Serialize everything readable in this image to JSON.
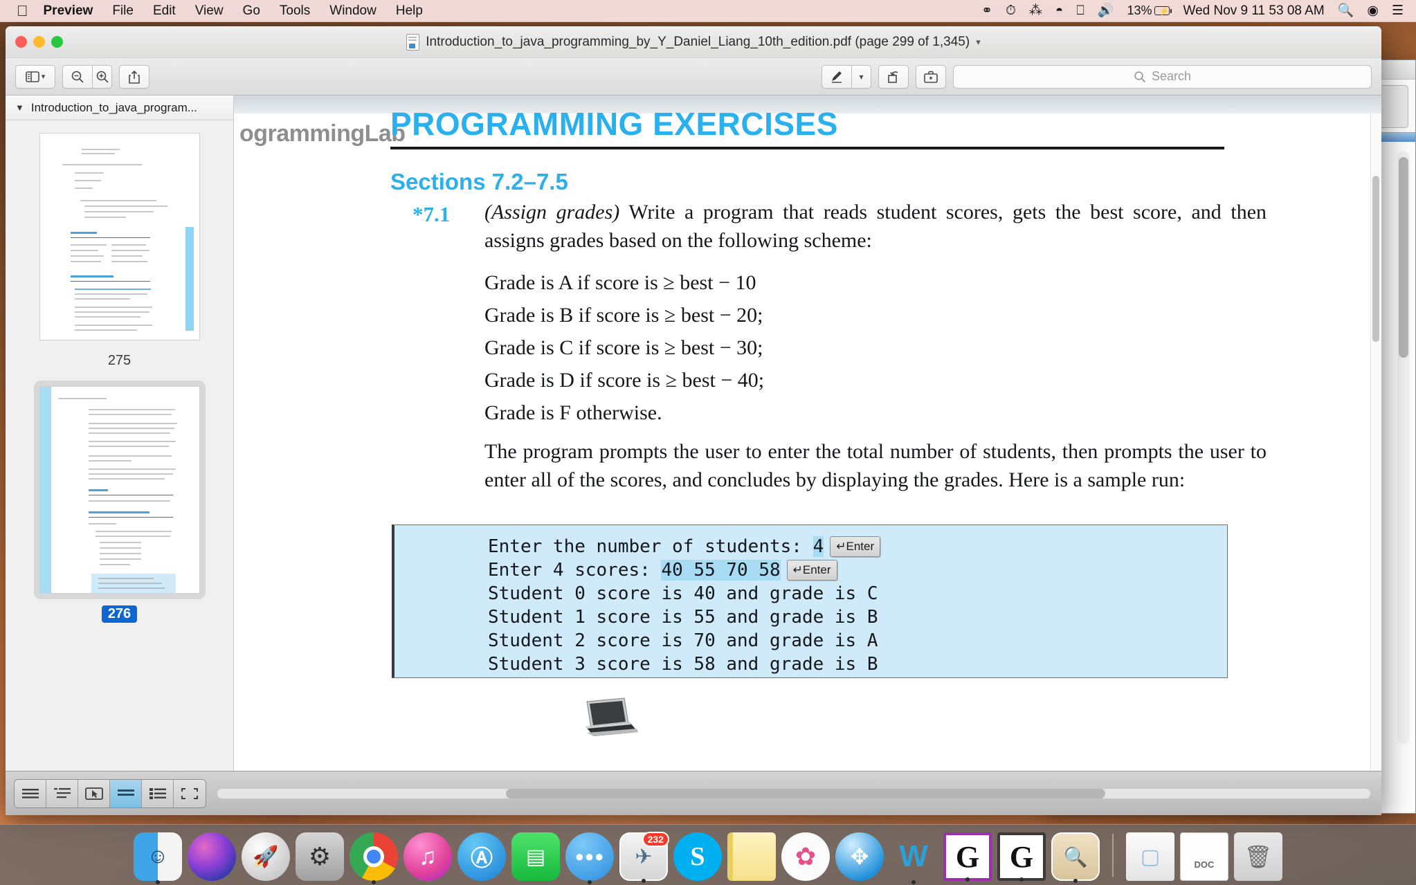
{
  "menubar": {
    "apple_icon": "apple-logo",
    "items": [
      {
        "label": "Preview",
        "bold": true
      },
      {
        "label": "File",
        "bold": false
      },
      {
        "label": "Edit",
        "bold": false
      },
      {
        "label": "View",
        "bold": false
      },
      {
        "label": "Go",
        "bold": false
      },
      {
        "label": "Tools",
        "bold": false
      },
      {
        "label": "Window",
        "bold": false
      },
      {
        "label": "Help",
        "bold": false
      }
    ],
    "status_icons": [
      "dropbox-icon",
      "time-machine-icon",
      "bluetooth-icon",
      "wifi-icon",
      "airplay-icon",
      "volume-icon"
    ],
    "battery_percent": "13%",
    "clock": "Wed Nov 9  11 53 08 AM",
    "right_icons": [
      "search-icon",
      "siri-icon",
      "notification-center-icon"
    ]
  },
  "window": {
    "title": "Introduction_to_java_programming_by_Y_Daniel_Liang_10th_edition.pdf (page 299 of 1,345)",
    "toolbar": {
      "sidebar_button": "sidebar-toggle",
      "zoom_out": "zoom-out",
      "zoom_in": "zoom-in",
      "share": "share",
      "markup": "markup-pen",
      "rotate": "rotate-left",
      "toolbox": "show-markup-toolbar"
    },
    "search": {
      "placeholder": "Search"
    }
  },
  "sidebar": {
    "header_title": "Introduction_to_java_program...",
    "thumbnails": [
      {
        "page_label": "275",
        "selected": false
      },
      {
        "page_label": "276",
        "selected": true
      }
    ]
  },
  "page": {
    "running_head": "ogrammingLab",
    "heading": "PROGRAMMING EXERCISES",
    "section": "Sections 7.2–7.5",
    "exercise_number": "*7.1",
    "intro_title": "(Assign grades)",
    "intro_text": " Write a program that reads student scores, gets the best score, and then assigns grades based on the following scheme:",
    "grade_rules": [
      "Grade is A if score is ≥ best − 10",
      "Grade is B if score is ≥ best − 20;",
      "Grade is C if score is ≥ best − 30;",
      "Grade is D if score is ≥ best − 40;",
      "Grade is F otherwise."
    ],
    "paragraph2": "The program prompts the user to enter the total number of students, then prompts the user to enter all of the scores, and concludes by displaying the grades. Here is a sample run:",
    "console": {
      "line1_prefix": "Enter the number of students: ",
      "line1_input": "4",
      "enter_key_label": "↵Enter",
      "line2_prefix": "Enter 4 scores: ",
      "line2_input": "40 55 70 58",
      "output_lines": [
        "Student 0 score is 40 and grade is C",
        "Student 1 score is 55 and grade is B",
        "Student 2 score is 70 and grade is A",
        "Student 3 score is 58 and grade is B"
      ]
    }
  },
  "bottom_bar": {
    "view_modes": [
      {
        "name": "continuous-single-page",
        "active": false
      },
      {
        "name": "table-of-contents",
        "active": false
      },
      {
        "name": "highlight-mode",
        "active": false
      },
      {
        "name": "single-page",
        "active": true
      },
      {
        "name": "contact-sheet",
        "active": false
      },
      {
        "name": "full-screen",
        "active": false
      }
    ]
  },
  "dock": {
    "apps": [
      {
        "name": "finder",
        "glyph": "☺",
        "color": "#2a9ce0",
        "running": true
      },
      {
        "name": "siri",
        "glyph": "◉",
        "color": "#7a3fbf",
        "running": false
      },
      {
        "name": "launchpad",
        "glyph": "🚀",
        "color": "#c9c9c9",
        "running": false
      },
      {
        "name": "system-preferences",
        "glyph": "⚙",
        "color": "#8e8e8e",
        "running": false
      },
      {
        "name": "google-chrome",
        "glyph": "◉",
        "color": "#ffffff",
        "running": true
      },
      {
        "name": "itunes",
        "glyph": "♫",
        "color": "#f05a9b",
        "running": false
      },
      {
        "name": "app-store",
        "glyph": "A",
        "color": "#1a8fe3",
        "running": false
      },
      {
        "name": "facetime",
        "glyph": "▣",
        "color": "#2cc84a",
        "running": false
      },
      {
        "name": "messages",
        "glyph": "●●●",
        "color": "#3aa0e8",
        "running": true
      },
      {
        "name": "mail",
        "glyph": "✉",
        "color": "#dedede",
        "running": true,
        "badge": "232"
      },
      {
        "name": "skype",
        "glyph": "S",
        "color": "#00aff0",
        "running": false
      },
      {
        "name": "notes",
        "glyph": "▤",
        "color": "#fde98a",
        "running": false
      },
      {
        "name": "photos",
        "glyph": "✿",
        "color": "#ffffff",
        "running": false
      },
      {
        "name": "safari",
        "glyph": "◎",
        "color": "#1f9ae0",
        "running": false
      },
      {
        "name": "microsoft-word",
        "glyph": "W",
        "color": "#2b9fd8",
        "running": true
      },
      {
        "name": "ghostscript-purple",
        "glyph": "G",
        "color": "#ffffff",
        "running": true
      },
      {
        "name": "ghostscript-gray",
        "glyph": "G",
        "color": "#ffffff",
        "running": true
      },
      {
        "name": "preview",
        "glyph": "▦",
        "color": "#e7d8b8",
        "running": true
      }
    ],
    "stacks": [
      {
        "name": "downloads-stack",
        "glyph": "▤",
        "color": "#f2f2f2"
      },
      {
        "name": "doc-file",
        "glyph": "DOC",
        "color": "#fbfbfb"
      },
      {
        "name": "trash",
        "glyph": "▽",
        "color": "#e3e3e3"
      }
    ]
  },
  "colors": {
    "accent_blue": "#2ab0ec",
    "console_bg": "#cfeaf8",
    "console_highlight": "#a7dcf3",
    "selection_blue": "#1066d0"
  }
}
